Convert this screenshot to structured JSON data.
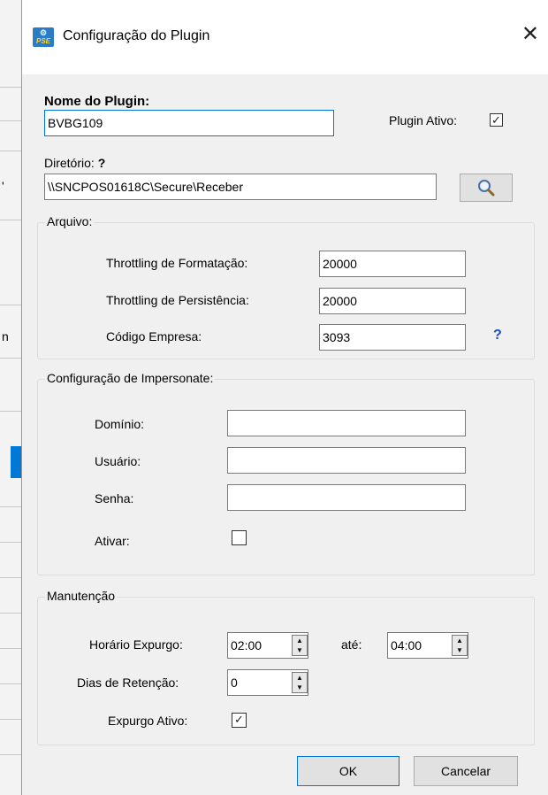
{
  "window": {
    "title": "Configuração do Plugin",
    "icon_text": "PSE",
    "close_glyph": "✕"
  },
  "background": {
    "fragment_1": "'",
    "fragment_2": "n"
  },
  "plugin": {
    "name_label": "Nome do Plugin:",
    "name_value": "BVBG109",
    "active_label": "Plugin Ativo:",
    "active_checked": true,
    "directory_label": "Diretório:",
    "directory_help": "?",
    "directory_value": "\\\\SNCPOS01618C\\Secure\\Receber",
    "browse_icon": "search-icon"
  },
  "arquivo": {
    "title": "Arquivo:",
    "throttling_format_label": "Throttling de Formatação:",
    "throttling_format_value": "20000",
    "throttling_persist_label": "Throttling de Persistência:",
    "throttling_persist_value": "20000",
    "company_code_label": "Código Empresa:",
    "company_code_value": "3093",
    "company_code_help": "?"
  },
  "impersonate": {
    "title": "Configuração de Impersonate:",
    "domain_label": "Domínio:",
    "domain_value": "",
    "user_label": "Usuário:",
    "user_value": "",
    "password_label": "Senha:",
    "password_value": "",
    "activate_label": "Ativar:",
    "activate_checked": false
  },
  "manutencao": {
    "title": "Manutenção",
    "purge_time_label": "Horário  Expurgo:",
    "purge_from": "02:00",
    "until_label": "até:",
    "purge_to": "04:00",
    "retention_label": "Dias de Retenção:",
    "retention_value": "0",
    "purge_active_label": "Expurgo Ativo:",
    "purge_active_checked": true
  },
  "buttons": {
    "ok": "OK",
    "cancel": "Cancelar"
  },
  "colors": {
    "accent": "#0078d7",
    "help": "#1c4fc4",
    "dialog_bg": "#f0f0f0"
  }
}
